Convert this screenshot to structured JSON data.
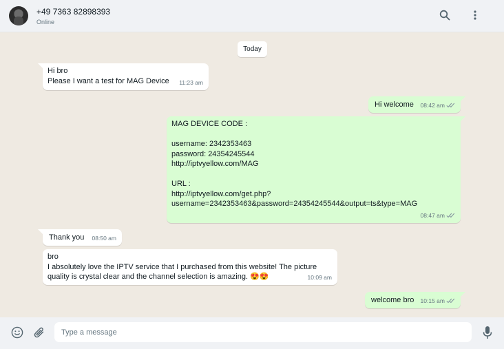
{
  "header": {
    "contact_name": "+49 7363 82898393",
    "status": "Online"
  },
  "date_divider": "Today",
  "messages": [
    {
      "direction": "incoming",
      "text": "Hi bro\nPlease I want a test for MAG Device",
      "time": "11:23 am"
    },
    {
      "direction": "outgoing",
      "text": "Hi welcome",
      "time": "08:42 am",
      "read": true
    },
    {
      "direction": "outgoing",
      "text": "MAG DEVICE CODE :\n\nusername: 2342353463\npassword: 24354245544\nhttp://iptvyellow.com/MAG\n\nURL :\nhttp://iptvyellow.com/get.php?\nusername=2342353463&password=24354245544&output=ts&type=MAG",
      "time": "08:47 am",
      "read": true
    },
    {
      "direction": "incoming",
      "text": "Thank you",
      "time": "08:50 am"
    },
    {
      "direction": "incoming",
      "text": "bro\nI absolutely love the IPTV service that I purchased from this website! The picture\nquality is crystal clear and the channel selection is amazing. 😍😍",
      "time": "10:09 am"
    },
    {
      "direction": "outgoing",
      "text": "welcome bro",
      "time": "10:15 am",
      "read": true
    }
  ],
  "composer": {
    "placeholder": "Type a message"
  },
  "icons": {
    "search": "search-icon",
    "menu": "kebab-menu-icon",
    "emoji": "emoji-icon",
    "attach": "paperclip-icon",
    "mic": "microphone-icon"
  },
  "colors": {
    "header_bg": "#f0f2f5",
    "chat_bg": "#efeae2",
    "incoming_bubble": "#ffffff",
    "outgoing_bubble": "#d9fdd3",
    "read_tick": "#53bdeb",
    "meta_text": "#667781"
  }
}
